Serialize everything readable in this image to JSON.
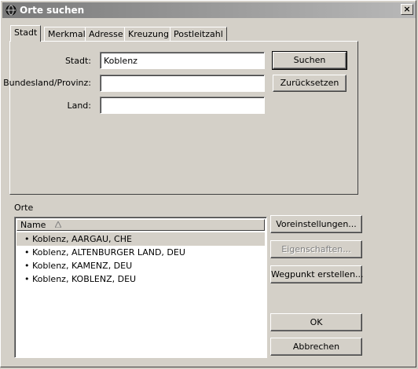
{
  "window": {
    "title": "Orte suchen",
    "close_glyph": "×"
  },
  "tabs": [
    {
      "label": "Stadt",
      "active": true
    },
    {
      "label": "Merkmal",
      "active": false
    },
    {
      "label": "Adresse",
      "active": false
    },
    {
      "label": "Kreuzung",
      "active": false
    },
    {
      "label": "Postleitzahl",
      "active": false
    }
  ],
  "form": {
    "city_label": "Stadt:",
    "city_value": "Koblenz",
    "state_label": "Bundesland/Provinz:",
    "state_value": "",
    "country_label": "Land:",
    "country_value": ""
  },
  "buttons": {
    "search": "Suchen",
    "reset": "Zurücksetzen",
    "preferences": "Voreinstellungen...",
    "properties": "Eigenschaften...",
    "create_waypoint": "Wegpunkt erstellen...",
    "ok": "OK",
    "cancel": "Abbrechen"
  },
  "results": {
    "group_label": "Orte",
    "column_header": "Name",
    "sort_icon": "sort-ascending-icon",
    "bullet": "•",
    "rows": [
      "Koblenz, AARGAU, CHE",
      "Koblenz, ALTENBURGER LAND, DEU",
      "Koblenz, KAMENZ, DEU",
      "Koblenz, KOBLENZ, DEU"
    ],
    "selected_index": 0
  }
}
